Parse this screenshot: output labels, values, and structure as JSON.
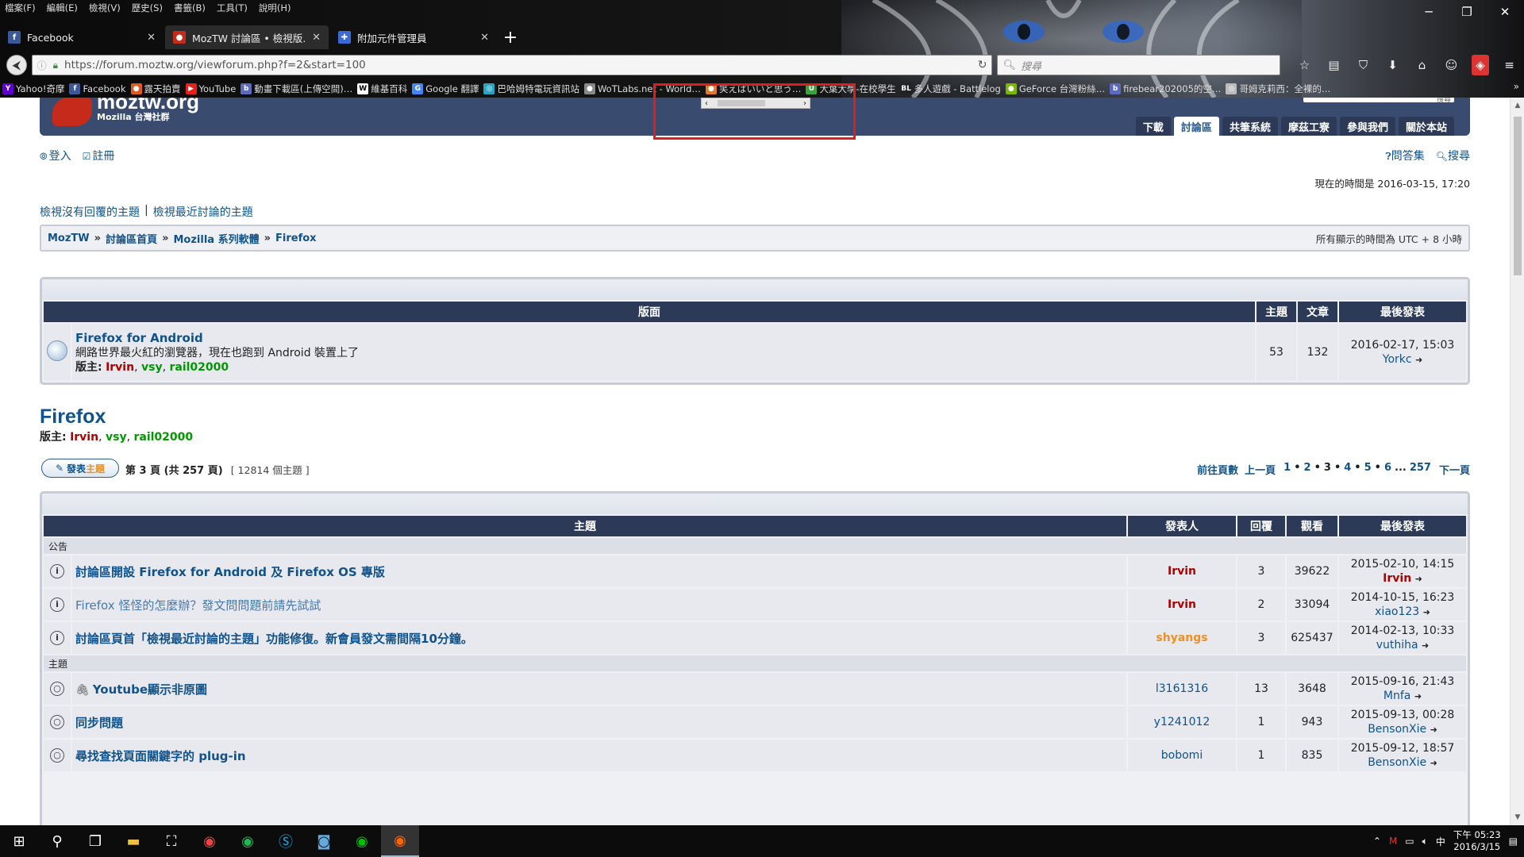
{
  "menubar": [
    "檔案(F)",
    "編輯(E)",
    "檢視(V)",
    "歷史(S)",
    "書籤(B)",
    "工具(T)",
    "說明(H)"
  ],
  "tabs": [
    {
      "title": "Facebook",
      "favicon": "f",
      "color": "#3b5998",
      "active": false
    },
    {
      "title": "MozTW 討論區 • 檢視版…",
      "favicon": "●",
      "color": "#c62a1a",
      "active": true
    },
    {
      "title": "附加元件管理員",
      "favicon": "✚",
      "color": "#3a6ad6",
      "active": false
    }
  ],
  "url": "https://forum.moztw.org/viewforum.php?f=2&start=100",
  "search_placeholder": "搜尋",
  "bookmarks": [
    {
      "label": "Yahoo!奇摩",
      "fav": "Y",
      "color": "#5f01d1"
    },
    {
      "label": "Facebook",
      "fav": "f",
      "color": "#3b5998"
    },
    {
      "label": "露天拍賣",
      "fav": "●",
      "color": "#e05a1e"
    },
    {
      "label": "YouTube",
      "fav": "▶",
      "color": "#e62117"
    },
    {
      "label": "動畫下載區(上傳空間)…",
      "fav": "b",
      "color": "#5b6abf"
    },
    {
      "label": "維基百科",
      "fav": "W",
      "color": "#fff"
    },
    {
      "label": "Google 翻譯",
      "fav": "G",
      "color": "#4285f4"
    },
    {
      "label": "巴哈姆特電玩資訊站",
      "fav": "◎",
      "color": "#2aa3c9"
    },
    {
      "label": "WoTLabs.net - World…",
      "fav": "●",
      "color": "#888"
    },
    {
      "label": "笑えばいいと思う…",
      "fav": "●",
      "color": "#e07a2a"
    },
    {
      "label": "大葉大學-在校學生",
      "fav": "U",
      "color": "#3aa33a"
    },
    {
      "label": "多人遊戲 - Battlelog",
      "fav": "BL",
      "color": "#222"
    },
    {
      "label": "GeForce 台灣粉絲…",
      "fav": "●",
      "color": "#76b900"
    },
    {
      "label": "firebear202005的空…",
      "fav": "b",
      "color": "#5b6abf"
    },
    {
      "label": "哥姆克莉西：全裸的…",
      "fav": "◎",
      "color": "#bbb"
    }
  ],
  "site": {
    "logo_name": "moztw.org",
    "logo_sub": "Mozilla 台灣社群",
    "mini_search_btn": "搜尋",
    "nav": [
      {
        "label": "下載",
        "active": false
      },
      {
        "label": "討論區",
        "active": true
      },
      {
        "label": "共筆系統",
        "active": false
      },
      {
        "label": "摩茲工寮",
        "active": false
      },
      {
        "label": "參與我們",
        "active": false
      },
      {
        "label": "關於本站",
        "active": false
      }
    ]
  },
  "user_links": {
    "login": "登入",
    "register": "註冊"
  },
  "right_links": {
    "faq": "問答集",
    "search": "搜尋"
  },
  "time_now": "現在的時間是 2016-03-15, 17:20",
  "search_links": {
    "unanswered": "檢視沒有回覆的主題",
    "active": "檢視最近討論的主題",
    "sep": "|"
  },
  "breadcrumb": {
    "items": [
      "MozTW",
      "討論區首頁",
      "Mozilla 系列軟體",
      "Firefox"
    ],
    "sep": "»",
    "timezone": "所有顯示的時間為 UTC + 8 小時"
  },
  "subforum_table": {
    "headers": {
      "forum": "版面",
      "topics": "主題",
      "posts": "文章",
      "last": "最後發表"
    },
    "row": {
      "title": "Firefox for Android",
      "desc": "網路世界最火紅的瀏覽器，現在也跑到 Android 裝置上了",
      "mods_label": "版主:",
      "mods": [
        {
          "name": "Irvin",
          "color": "red"
        },
        {
          "name": "vsy",
          "color": "green"
        },
        {
          "name": "rail02000",
          "color": "green"
        }
      ],
      "topics": "53",
      "posts": "132",
      "last_date": "2016-02-17, 15:03",
      "last_user": "Yorkc"
    }
  },
  "forum": {
    "title": "Firefox",
    "mods_label": "版主:",
    "mods": [
      {
        "name": "Irvin",
        "color": "red"
      },
      {
        "name": "vsy",
        "color": "green"
      },
      {
        "name": "rail02000",
        "color": "green"
      }
    ]
  },
  "post_button": {
    "a": "發表",
    "b": "主題"
  },
  "page_info": {
    "page": "第 3 頁 (共 257 頁)",
    "count": "[ 12814 個主題 ]"
  },
  "pager": {
    "goto": "前往頁數",
    "prev": "上一頁",
    "pages": [
      "1",
      "2",
      "3",
      "4",
      "5",
      "6"
    ],
    "ellipsis": "...",
    "last": "257",
    "next": "下一頁"
  },
  "topics_table": {
    "headers": {
      "topic": "主題",
      "author": "發表人",
      "replies": "回覆",
      "views": "觀看",
      "last": "最後發表"
    },
    "announce_label": "公告",
    "topics_label": "主題",
    "announcements": [
      {
        "title": "討論區開設 Firefox for Android 及 Firefox OS 專版",
        "visited": false,
        "author": "Irvin",
        "author_color": "red",
        "replies": "3",
        "views": "39622",
        "last_date": "2015-02-10, 14:15",
        "last_user": "Irvin",
        "last_color": "red"
      },
      {
        "title": "Firefox 怪怪的怎麼辦？發文問問題前請先試試",
        "visited": true,
        "author": "Irvin",
        "author_color": "red",
        "replies": "2",
        "views": "33094",
        "last_date": "2014-10-15, 16:23",
        "last_user": "xiao123",
        "last_color": "blue"
      },
      {
        "title": "討論區頁首「檢視最近討論的主題」功能修復。新會員發文需間隔10分鐘。",
        "visited": false,
        "author": "shyangs",
        "author_color": "orange",
        "replies": "3",
        "views": "625437",
        "last_date": "2014-02-13, 10:33",
        "last_user": "vuthiha",
        "last_color": "blue"
      }
    ],
    "topics": [
      {
        "title": "Youtube顯示非原圖",
        "attach": true,
        "author": "l3161316",
        "author_color": "blue",
        "replies": "13",
        "views": "3648",
        "last_date": "2015-09-16, 21:43",
        "last_user": "Mnfa",
        "last_color": "blue"
      },
      {
        "title": "同步問題",
        "attach": false,
        "author": "y1241012",
        "author_color": "blue",
        "replies": "1",
        "views": "943",
        "last_date": "2015-09-13, 00:28",
        "last_user": "BensonXie",
        "last_color": "blue"
      },
      {
        "title": "尋找查找頁面關鍵字的 plug-in",
        "attach": false,
        "author": "bobomi",
        "author_color": "blue",
        "replies": "1",
        "views": "835",
        "last_date": "2015-09-12, 18:57",
        "last_user": "BensonXie",
        "last_color": "blue"
      }
    ]
  },
  "clock": {
    "time": "下午 05:23",
    "date": "2016/3/15"
  }
}
